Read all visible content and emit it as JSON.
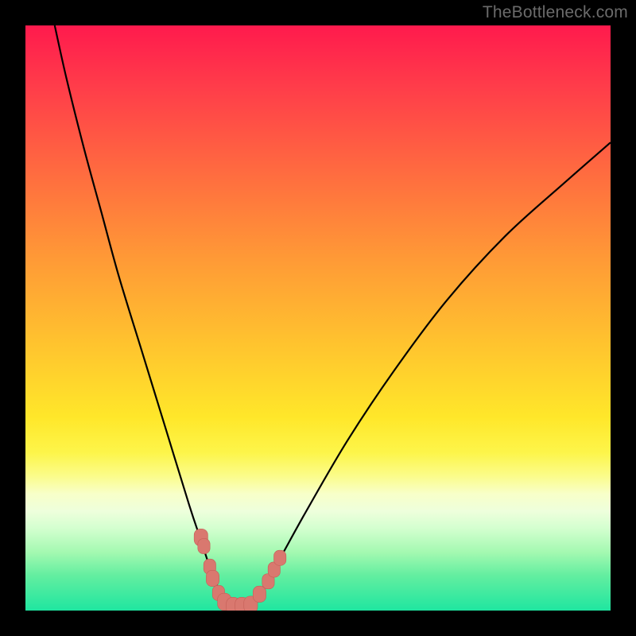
{
  "watermark": "TheBottleneck.com",
  "colors": {
    "frame": "#000000",
    "curve": "#000000",
    "marker_fill": "#d9786f",
    "marker_stroke": "#c55f57",
    "gradient_top": "#ff1a4d",
    "gradient_bottom": "#1fe6a0"
  },
  "chart_data": {
    "type": "line",
    "title": "",
    "xlabel": "",
    "ylabel": "",
    "xlim": [
      0,
      100
    ],
    "ylim": [
      0,
      100
    ],
    "series": [
      {
        "name": "bottleneck-curve",
        "x": [
          5,
          7,
          10,
          13,
          16,
          20,
          24,
          28,
          30,
          32,
          33.5,
          35,
          36.5,
          38,
          40,
          43,
          48,
          55,
          63,
          72,
          82,
          92,
          100
        ],
        "y": [
          100,
          91,
          79,
          68,
          57,
          44,
          31,
          18,
          12,
          6,
          3,
          1,
          0.5,
          1,
          3,
          8,
          17,
          29,
          41,
          53,
          64,
          73,
          80
        ]
      }
    ],
    "markers": [
      {
        "x": 30.0,
        "y": 12.5,
        "r": 1.8
      },
      {
        "x": 30.5,
        "y": 11.0,
        "r": 1.6
      },
      {
        "x": 31.5,
        "y": 7.5,
        "r": 1.6
      },
      {
        "x": 32.0,
        "y": 5.5,
        "r": 1.7
      },
      {
        "x": 33.0,
        "y": 3.0,
        "r": 1.6
      },
      {
        "x": 34.0,
        "y": 1.5,
        "r": 1.8
      },
      {
        "x": 35.5,
        "y": 0.8,
        "r": 1.8
      },
      {
        "x": 37.0,
        "y": 0.8,
        "r": 1.8
      },
      {
        "x": 38.5,
        "y": 1.0,
        "r": 1.8
      },
      {
        "x": 40.0,
        "y": 2.8,
        "r": 1.7
      },
      {
        "x": 41.5,
        "y": 5.0,
        "r": 1.6
      },
      {
        "x": 42.5,
        "y": 7.0,
        "r": 1.6
      },
      {
        "x": 43.5,
        "y": 9.0,
        "r": 1.6
      }
    ],
    "annotations": []
  }
}
